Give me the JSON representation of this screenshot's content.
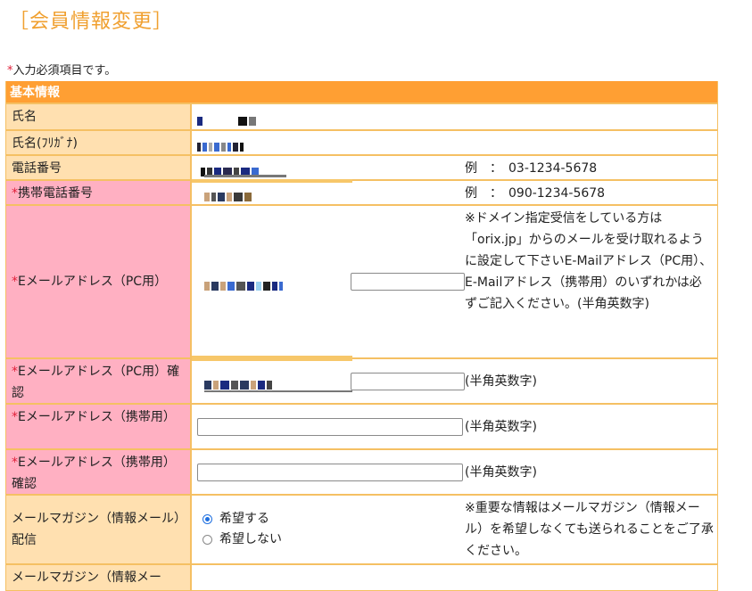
{
  "page": {
    "title": "［会員情報変更］",
    "required_note": "入力必須項目です。",
    "required_mark": "*"
  },
  "section": {
    "basic_info": "基本情報"
  },
  "rows": {
    "name": {
      "label": "氏名"
    },
    "name_kana": {
      "label": "氏名(ﾌﾘｶﾞﾅ)"
    },
    "phone": {
      "label": "電話番号",
      "example": "例　：　03-1234-5678"
    },
    "mobile": {
      "label": "携帯電話番号",
      "example": "例　：　090-1234-5678"
    },
    "email_pc": {
      "label": "Eメールアドレス（PC用）",
      "note": "※ドメイン指定受信をしている方は「orix.jp」からのメールを受け取れるように設定して下さいE-Mailアドレス（PC用）、E-Mailアドレス（携帯用）のいずれかは必ずご記入ください。(半角英数字)"
    },
    "email_pc_confirm": {
      "label": "Eメールアドレス（PC用）確認",
      "note": "(半角英数字)"
    },
    "email_mobile": {
      "label": "Eメールアドレス（携帯用）",
      "note": "(半角英数字)"
    },
    "email_mobile_confirm": {
      "label": "Eメールアドレス（携帯用）確認",
      "note": "(半角英数字)"
    },
    "magazine": {
      "label": "メールマガジン（情報メール）配信",
      "opt_yes": "希望する",
      "opt_no": "希望しない",
      "note": "※重要な情報はメールマガジン（情報メール）を希望しなくても送られることをご了承ください。"
    },
    "magazine2": {
      "label": "メールマガジン（情報メー"
    }
  }
}
